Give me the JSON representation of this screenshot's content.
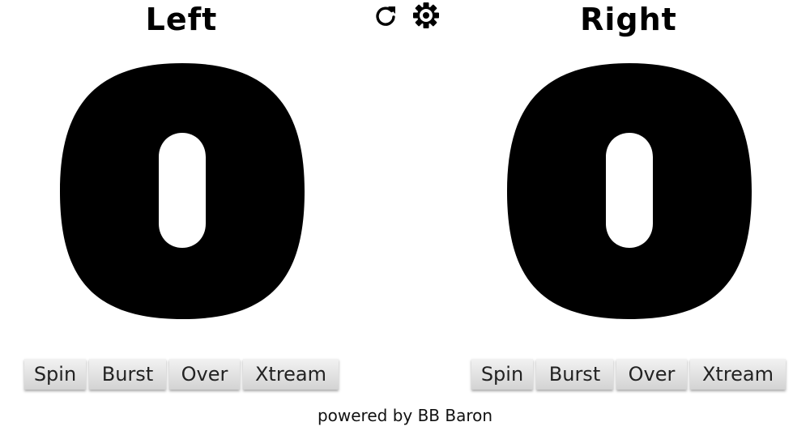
{
  "players": {
    "left": {
      "title": "Left",
      "score": "0"
    },
    "right": {
      "title": "Right",
      "score": "0"
    }
  },
  "toolbar": {
    "icons": [
      "refresh-icon",
      "gear-icon"
    ]
  },
  "finish_buttons": {
    "spin": "Spin",
    "burst": "Burst",
    "over": "Over",
    "xtream": "Xtream"
  },
  "footer": {
    "text": "powered by BB Baron"
  }
}
